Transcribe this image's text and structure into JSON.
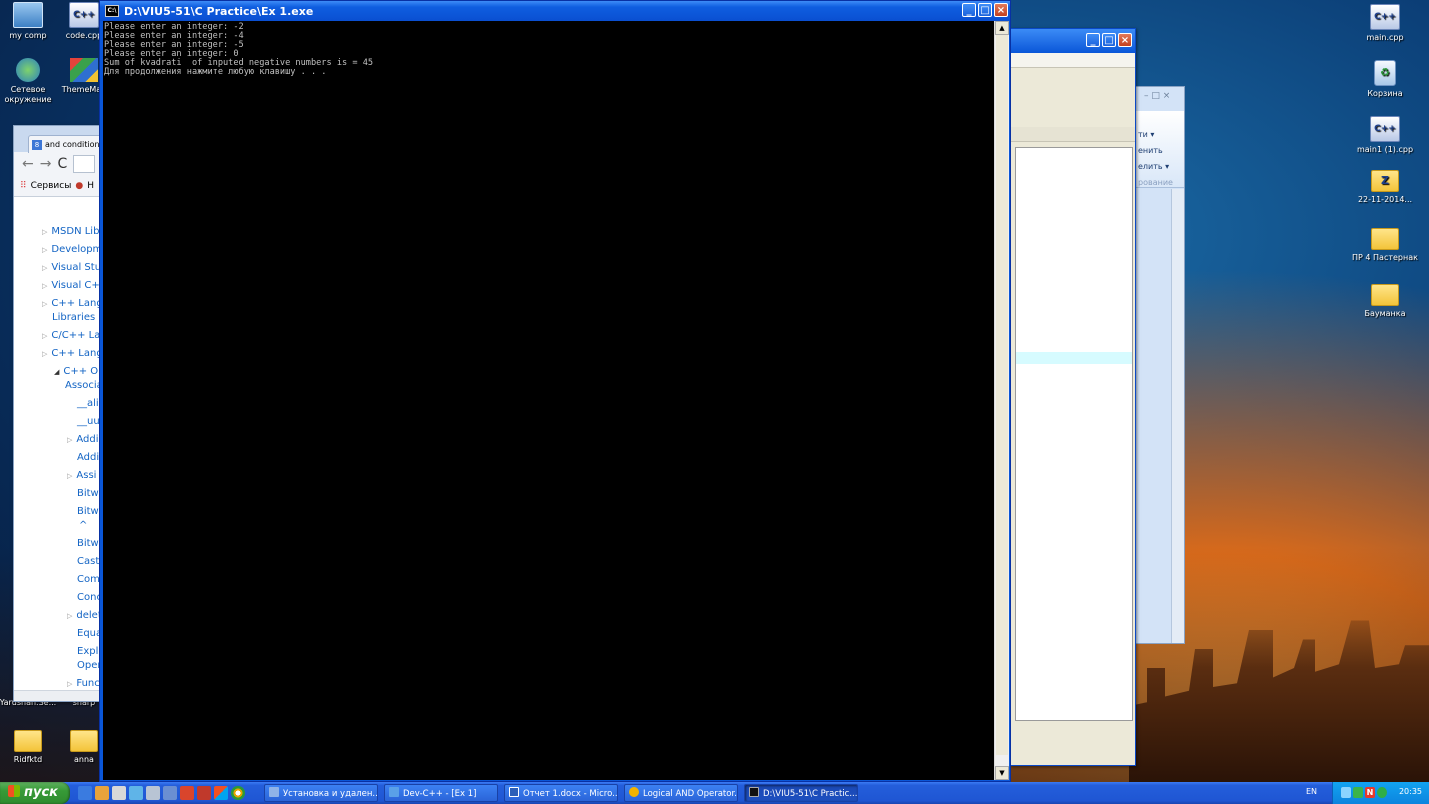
{
  "desktop": {
    "icons_left": [
      {
        "label": "my comp",
        "icon": "computer-icon"
      },
      {
        "label": "code.cpp",
        "icon": "cpp-file-icon"
      },
      {
        "label": "Сетевое окружение",
        "icon": "network-icon"
      },
      {
        "label": "ThemeMan",
        "icon": "theme-icon"
      },
      {
        "label": "Yarushan.Se...",
        "icon": "file-icon"
      },
      {
        "label": "sharp",
        "icon": "file-icon"
      },
      {
        "label": "Ridfktd",
        "icon": "folder-icon"
      },
      {
        "label": "anna",
        "icon": "folder-icon"
      }
    ],
    "icons_right": [
      {
        "label": "main.cpp",
        "icon": "cpp-file-icon"
      },
      {
        "label": "Корзина",
        "icon": "recycle-bin-icon"
      },
      {
        "label": "main1 (1).cpp",
        "icon": "cpp-file-icon"
      },
      {
        "label": "22-11-2014...",
        "icon": "zip-folder-icon"
      },
      {
        "label": "ПР 4 Пастернак",
        "icon": "folder-icon"
      },
      {
        "label": "Бауманка",
        "icon": "folder-icon"
      }
    ]
  },
  "browser": {
    "tab_title": "and condition i",
    "bookmarks": [
      "Сервисы",
      "Н"
    ],
    "toc": [
      "MSDN Lib",
      "Developm",
      "Visual Stu",
      "Visual C+-",
      "C++ Lang",
      "Libraries",
      "C/C++ La",
      "C++ Lang",
      "C++ O",
      "Associa",
      "__ali",
      "__uu",
      "Addi",
      "Addi",
      "Assi",
      "Bitwi",
      "Bitwi",
      "^",
      "Bitwi",
      "Cast",
      "Com",
      "Conc",
      "delet",
      "Equa",
      "Expli",
      "Oper",
      "Func"
    ]
  },
  "word": {
    "ribbon": [
      "ти ▾",
      "енить",
      "елить ▾",
      "рование"
    ]
  },
  "console": {
    "title": "D:\\VIU5-51\\C Practice\\Ex 1.exe",
    "system_icon": "C:\\",
    "lines": [
      "Please enter an integer: -2",
      "Please enter an integer: -4",
      "Please enter an integer: -5",
      "Please enter an integer: 0",
      "Sum of kvadrati  of inputed negative numbers is = 45",
      "Для продолжения нажмите любую клавишу . . ."
    ],
    "buttons": {
      "minimize": "_",
      "maximize": "□",
      "close": "×"
    }
  },
  "taskbar": {
    "start_label": "пуск",
    "tasks": [
      {
        "label": "Установка и удален...",
        "color": "#8fb3e8"
      },
      {
        "label": "Dev-C++ - [Ex 1]",
        "color": "#5aa0e8"
      },
      {
        "label": "Отчет 1.docx - Micro...",
        "color": "#2d5fb8"
      },
      {
        "label": "Logical AND Operator...",
        "color": "#f2b300"
      },
      {
        "label": "D:\\VIU5-51\\C Practic...",
        "color": "#111111"
      }
    ],
    "language": "EN",
    "clock": "20:35"
  }
}
